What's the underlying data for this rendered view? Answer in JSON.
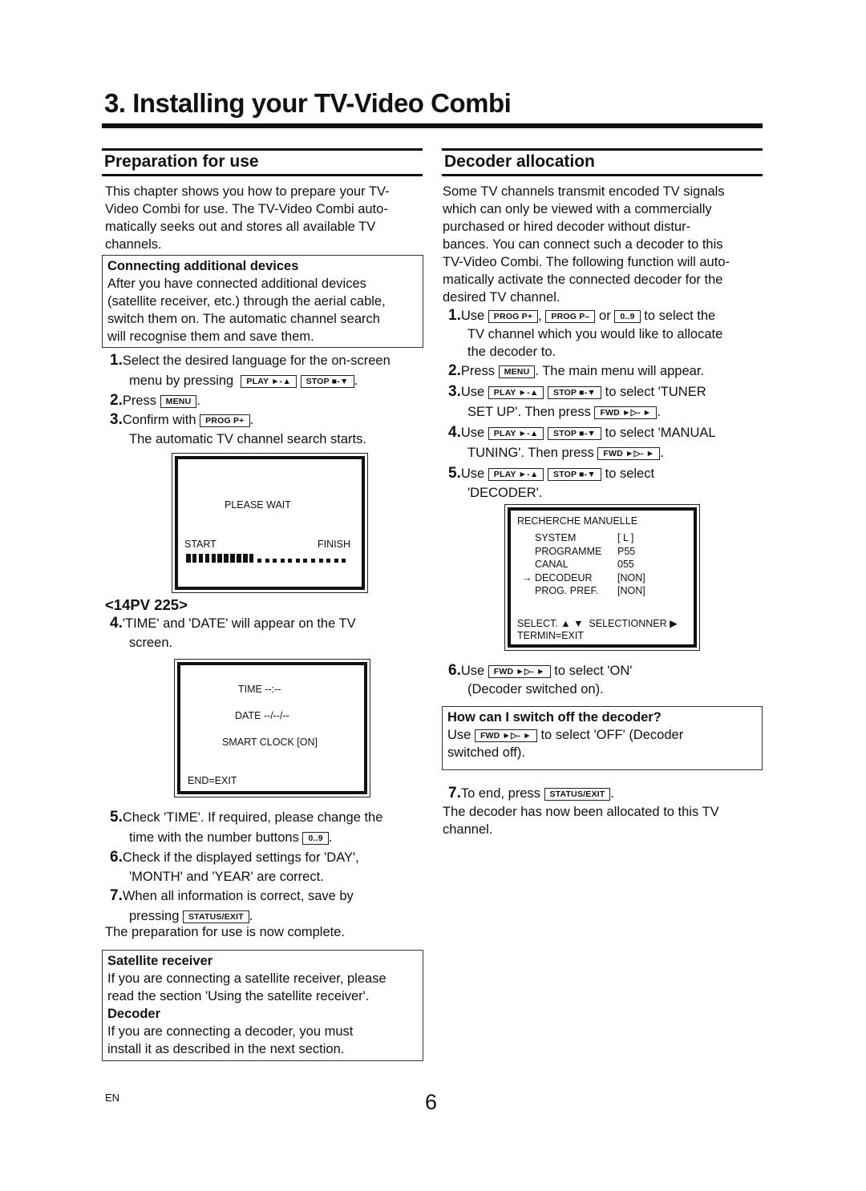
{
  "page": {
    "title": "3. Installing your TV-Video Combi",
    "footer_lang": "EN",
    "page_number": "6"
  },
  "left": {
    "heading": "Preparation for use",
    "intro": [
      "This chapter shows you how to prepare your TV-",
      "Video Combi for use. The TV-Video Combi auto-",
      "matically seeks out and stores all available TV",
      "channels."
    ],
    "box1": {
      "title": "Connecting additional devices",
      "lines": [
        "After you have connected additional devices",
        "(satellite receiver, etc.) through the aerial cable,",
        "switch them on. The automatic channel search",
        "will recognise them and save them."
      ]
    },
    "steps": {
      "s1_num": "1.",
      "s1_a": "Select the desired language for the on-screen",
      "s1_b": "menu by pressing",
      "s2_num": "2.",
      "s2_a": "Press",
      "s3_num": "3.",
      "s3_a": "Confirm with",
      "s3_b": "The automatic TV channel search starts."
    },
    "screen1": {
      "message": "PLEASE WAIT",
      "start_label": "START",
      "finish_label": "FINISH",
      "progress": {
        "filled_blocks": 11,
        "total_blocks": 23,
        "percent": 48
      }
    },
    "model_label": "<14PV 225>",
    "step4": {
      "num": "4.",
      "a": "'TIME' and 'DATE' will appear on the TV",
      "b": "screen."
    },
    "screen2": {
      "time": "TIME --:--",
      "date": "DATE --/--/--",
      "smart_clock": "SMART CLOCK [ON]",
      "exit": "END=EXIT"
    },
    "step5": {
      "num": "5.",
      "a": "Check 'TIME'. If required, please change the",
      "b": "time with the number buttons"
    },
    "step6": {
      "num": "6.",
      "a": "Check if the displayed settings for 'DAY',",
      "b": "'MONTH' and 'YEAR' are correct."
    },
    "step7": {
      "num": "7.",
      "a": "When all information is correct, save by",
      "b": "pressing"
    },
    "complete": "The preparation for use is now complete.",
    "box2": {
      "title1": "Satellite receiver",
      "lines1": [
        "If you are connecting a satellite receiver, please",
        "read the section 'Using the satellite receiver'."
      ],
      "title2": "Decoder",
      "lines2": [
        "If you are connecting a decoder, you must",
        "install it as described in the next section."
      ]
    }
  },
  "right": {
    "heading": "Decoder allocation",
    "intro": [
      "Some TV channels transmit encoded TV signals",
      "which can only be viewed with a commercially",
      "purchased or hired decoder without distur-",
      "bances. You can connect such a decoder to this",
      "TV-Video Combi. The following function will auto-",
      "matically activate the connected decoder for the",
      "desired TV channel."
    ],
    "step1": {
      "num": "1.",
      "a": "Use",
      "sep1": ",",
      "or": "or",
      "b": "to select the",
      "c": "TV channel which you would like to allocate",
      "d": "the decoder to."
    },
    "step2": {
      "num": "2.",
      "a": "Press",
      "b": ". The main menu will appear."
    },
    "step3": {
      "num": "3.",
      "a": "Use",
      "b": "to select 'TUNER",
      "c": "SET UP'. Then press"
    },
    "step4": {
      "num": "4.",
      "a": "Use",
      "b": "to select 'MANUAL",
      "c": "TUNING'. Then press"
    },
    "step5": {
      "num": "5.",
      "a": "Use",
      "b": "to select",
      "c": "'DECODER'."
    },
    "screen3": {
      "title": "RECHERCHE MANUELLE",
      "rows": [
        {
          "label": "SYSTEM",
          "value": "[ L ]",
          "selected": false
        },
        {
          "label": "PROGRAMME",
          "value": "P55",
          "selected": false
        },
        {
          "label": "CANAL",
          "value": "055",
          "selected": false
        },
        {
          "label": "DECODEUR",
          "value": "[NON]",
          "selected": true
        },
        {
          "label": "PROG. PREF.",
          "value": "[NON]",
          "selected": false
        }
      ],
      "cursor": "→",
      "select_hint": "SELECT.",
      "select_hint2": "SELECTIONNER",
      "exit": "TERMIN=EXIT"
    },
    "step6": {
      "num": "6.",
      "a": "Use",
      "b": "to select 'ON'",
      "c": "(Decoder switched on)."
    },
    "box": {
      "title": "How can I switch off the decoder?",
      "a": "Use",
      "b": "to select 'OFF' (Decoder",
      "c": "switched off)."
    },
    "step7": {
      "num": "7.",
      "a": "To end, press"
    },
    "outro": [
      "The decoder has now been allocated to this TV",
      "channel."
    ]
  },
  "keys": {
    "play": "PLAY ►-▲",
    "stop": "STOP ■-▼",
    "menu": "MENU",
    "prog_plus": "PROG P+",
    "prog_minus": "PROG P–",
    "digits": "0..9",
    "status_exit": "STATUS/EXIT",
    "fwd": "FWD ►▷- ►"
  }
}
